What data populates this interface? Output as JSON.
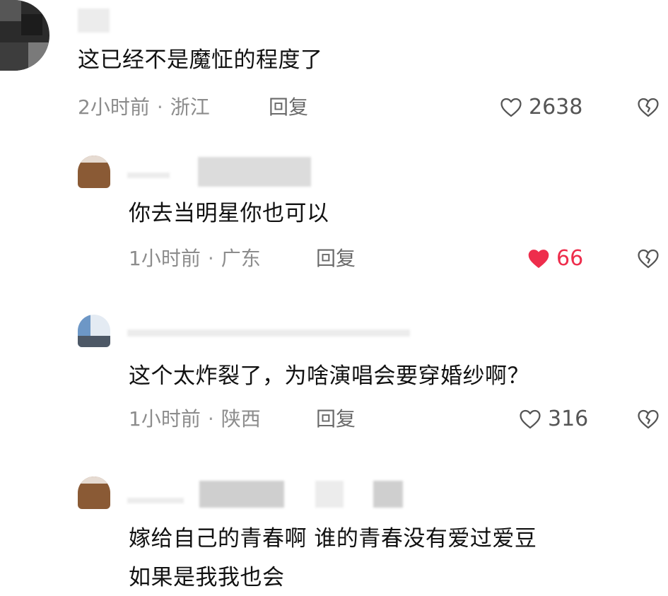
{
  "comments": [
    {
      "text": "这已经不是魔怔的程度了",
      "time": "2小时前",
      "location": "浙江",
      "reply_label": "回复",
      "likes": "2638",
      "liked": false
    },
    {
      "text": "你去当明星你也可以",
      "time": "1小时前",
      "location": "广东",
      "reply_label": "回复",
      "likes": "66",
      "liked": true
    },
    {
      "text": "这个太炸裂了，为啥演唱会要穿婚纱啊？",
      "time": "1小时前",
      "location": "陕西",
      "reply_label": "回复",
      "likes": "316",
      "liked": false
    },
    {
      "text_line1": "嫁给自己的青春啊 谁的青春没有爱过爱豆",
      "text_line2": "如果是我我也会"
    }
  ],
  "separator": "·",
  "icons": {
    "like": "heart-outline-icon",
    "liked": "heart-filled-icon",
    "dislike": "broken-heart-icon"
  },
  "colors": {
    "liked": "#ee2d4c",
    "meta": "#8c8c8c",
    "text": "#111111"
  }
}
